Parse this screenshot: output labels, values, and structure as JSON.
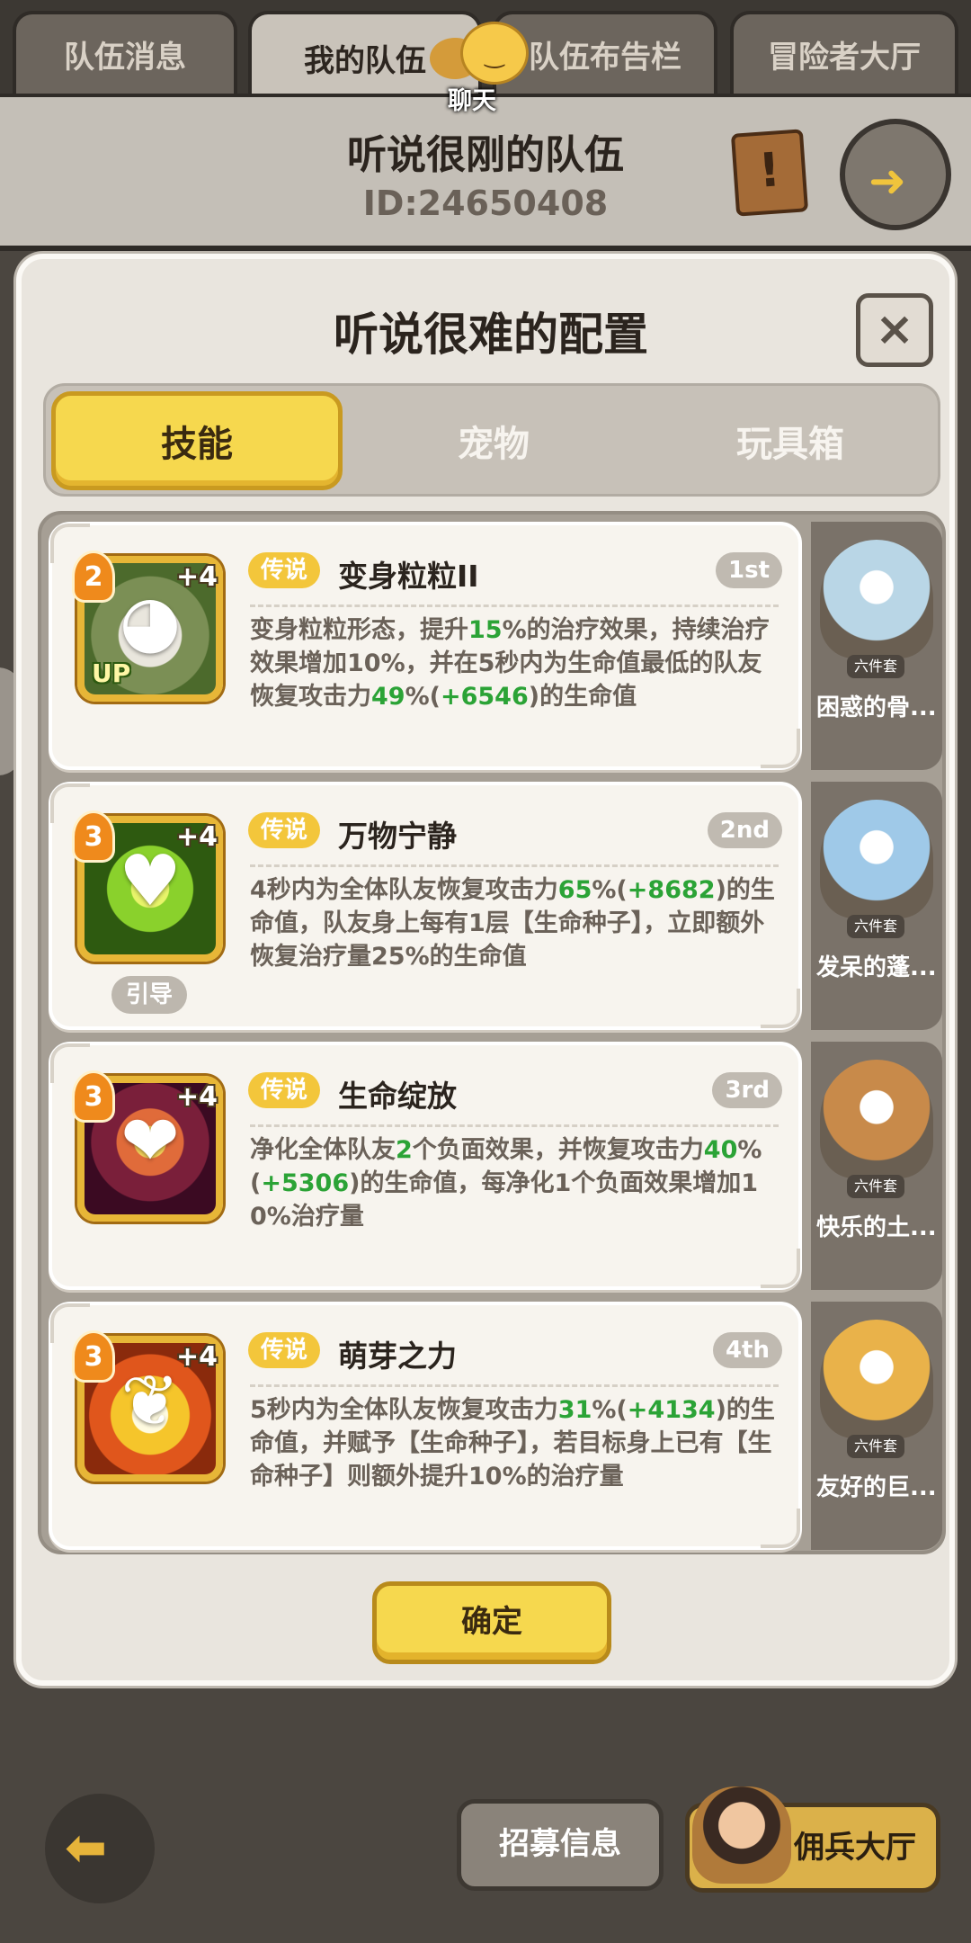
{
  "top_tabs": [
    "队伍消息",
    "我的队伍",
    "队伍布告栏",
    "冒险者大厅"
  ],
  "chat_label": "聊天",
  "team": {
    "name": "听说很刚的队伍",
    "id": "ID:24650408"
  },
  "modal": {
    "title": "听说很难的配置",
    "close": "×",
    "segments": [
      "技能",
      "宠物",
      "玩具箱"
    ],
    "confirm": "确定"
  },
  "skills": [
    {
      "level": "2",
      "plus": "+4",
      "rarity": "传说",
      "name": "变身粒粒II",
      "rank": "1st",
      "tag": "UP",
      "icon": "owl-icon",
      "desc": [
        {
          "t": "变身粒粒形态，提升",
          "g": false
        },
        {
          "t": "15",
          "g": true
        },
        {
          "t": "%的治疗效果，持续治疗效果增加10%，并在5秒内为生命值最低的队友恢复攻击力",
          "g": false
        },
        {
          "t": "49",
          "g": true
        },
        {
          "t": "%(",
          "g": false
        },
        {
          "t": "+6546",
          "g": true
        },
        {
          "t": ")的生命值",
          "g": false
        }
      ]
    },
    {
      "level": "3",
      "plus": "+4",
      "rarity": "传说",
      "name": "万物宁静",
      "rank": "2nd",
      "guide": "引导",
      "icon": "heart-leaf-icon",
      "desc": [
        {
          "t": "4秒内为全体队友恢复攻击力",
          "g": false
        },
        {
          "t": "65",
          "g": true
        },
        {
          "t": "%(",
          "g": false
        },
        {
          "t": "+8682",
          "g": true
        },
        {
          "t": ")的生命值，队友身上每有1层【生命种子】，立即额外恢复治疗量25%的生命值",
          "g": false
        }
      ]
    },
    {
      "level": "3",
      "plus": "+4",
      "rarity": "传说",
      "name": "生命绽放",
      "rank": "3rd",
      "icon": "heart-flower-icon",
      "desc": [
        {
          "t": "净化全体队友",
          "g": false
        },
        {
          "t": "2",
          "g": true
        },
        {
          "t": "个负面效果，并恢复攻击力",
          "g": false
        },
        {
          "t": "40",
          "g": true
        },
        {
          "t": "%(",
          "g": false
        },
        {
          "t": "+5306",
          "g": true
        },
        {
          "t": ")的生命值，每净化1个负面效果增加10%治疗量",
          "g": false
        }
      ]
    },
    {
      "level": "3",
      "plus": "+4",
      "rarity": "传说",
      "name": "萌芽之力",
      "rank": "4th",
      "icon": "sprout-icon",
      "desc": [
        {
          "t": "5秒内为全体队友恢复攻击力",
          "g": false
        },
        {
          "t": "31",
          "g": true
        },
        {
          "t": "%(",
          "g": false
        },
        {
          "t": "+4134",
          "g": true
        },
        {
          "t": ")的生命值，并赋予【生命种子】，若目标身上已有【生命种子】则额外提升10%的治疗量",
          "g": false
        }
      ]
    }
  ],
  "heroes": [
    {
      "name": "困惑的骨...",
      "tag": "六件套",
      "color": "#b9d6e6"
    },
    {
      "name": "发呆的蓬...",
      "tag": "六件套",
      "color": "#9fc9e8"
    },
    {
      "name": "快乐的土...",
      "tag": "六件套",
      "color": "#c88a4a"
    },
    {
      "name": "友好的巨...",
      "tag": "六件套",
      "color": "#e9b24a"
    }
  ],
  "bottom": {
    "recruit": "招募信息",
    "mercenary": "佣兵大厅"
  }
}
